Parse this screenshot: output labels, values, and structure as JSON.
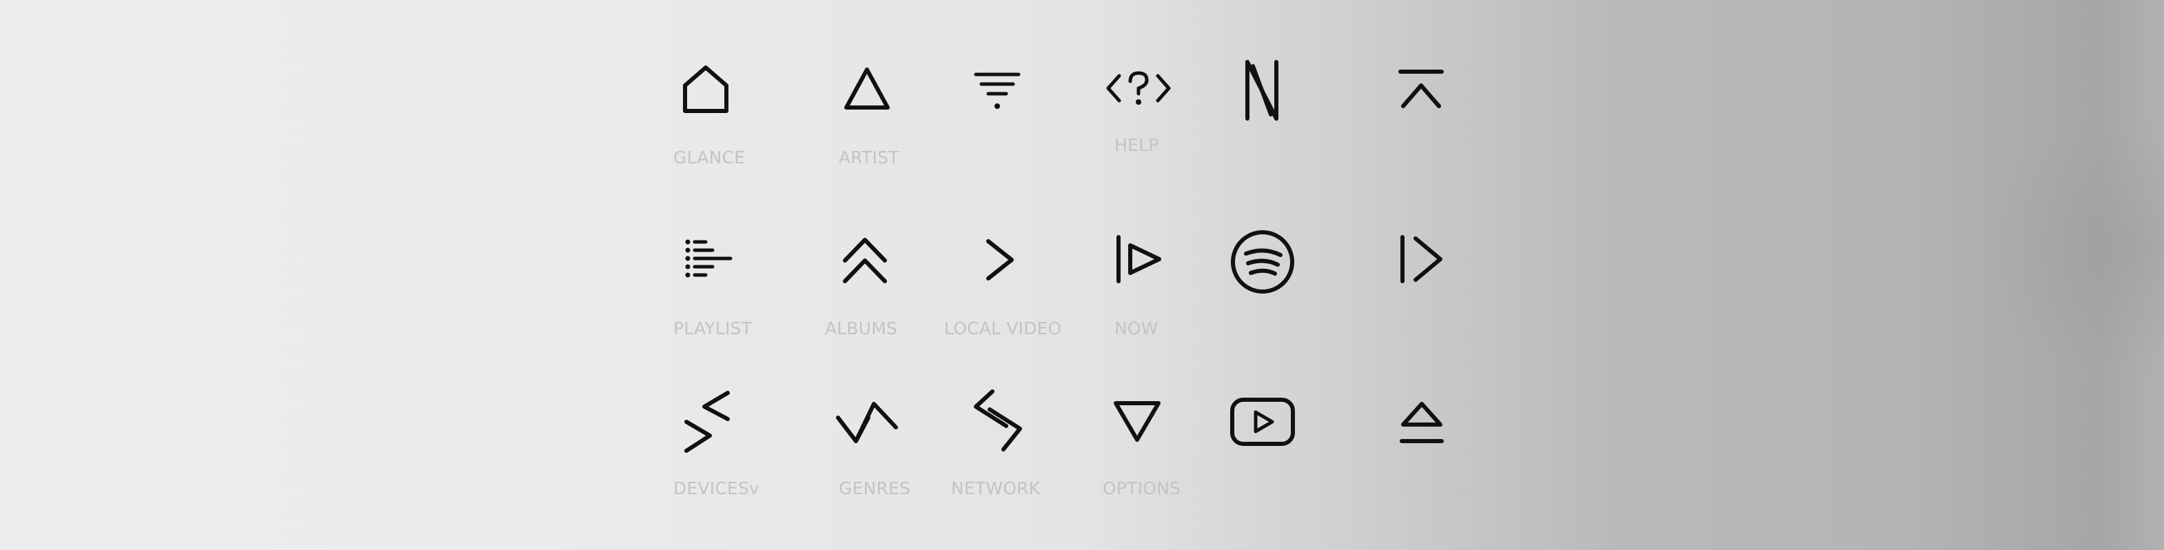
{
  "icon_color": "#111111",
  "label_color": "#c4c4c4",
  "grid": {
    "rows": [
      [
        {
          "icon": "home-icon",
          "label": "GLANCE"
        },
        {
          "icon": "triangle-up-icon",
          "label": "ARTIST"
        },
        {
          "icon": "filter-icon",
          "label": ""
        },
        {
          "icon": "code-help-icon",
          "label": "HELP"
        },
        {
          "icon": "netflix-icon",
          "label": ""
        },
        {
          "icon": "scroll-top-icon",
          "label": ""
        }
      ],
      [
        {
          "icon": "playlist-lines-icon",
          "label": "PLAYLIST"
        },
        {
          "icon": "double-chevron-up-icon",
          "label": "ALBUMS"
        },
        {
          "icon": "chevron-right-icon",
          "label": "LOCAL VIDEO"
        },
        {
          "icon": "play-next-icon",
          "label": "NOW"
        },
        {
          "icon": "spotify-icon",
          "label": ""
        },
        {
          "icon": "bar-chevron-right-icon",
          "label": "PLAYBA..."
        }
      ],
      [
        {
          "icon": "devices-icon",
          "label": "DEVICESv"
        },
        {
          "icon": "genres-icon",
          "label": "GENRES"
        },
        {
          "icon": "network-icon",
          "label": "NETWORK"
        },
        {
          "icon": "triangle-down-icon",
          "label": "OPTIONS"
        },
        {
          "icon": "youtube-icon",
          "label": ""
        },
        {
          "icon": "eject-icon",
          "label": "PERSONA..."
        }
      ]
    ]
  }
}
